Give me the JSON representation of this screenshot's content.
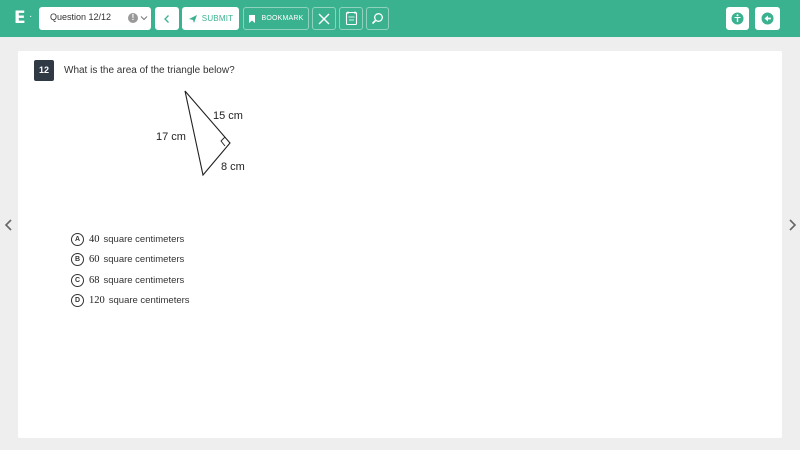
{
  "topbar": {
    "logo": "E",
    "question_select": "Question 12/12",
    "submit_label": "SUBMIT",
    "bookmark_label": "BOOKMARK",
    "colors": {
      "bar": "#3bb28f",
      "dark": "#2f3a45"
    },
    "icons": [
      "info-icon",
      "chevron-down-icon",
      "back-arrow-icon",
      "send-icon",
      "bookmark-icon",
      "close-icon",
      "calculator-icon",
      "search-icon",
      "accessibility-icon",
      "exit-icon"
    ]
  },
  "question": {
    "number": "12",
    "text": "What is the area of the triangle below?",
    "figure": {
      "side_hypotenuse": "17 cm",
      "side_a": "15 cm",
      "side_b": "8 cm"
    }
  },
  "choices": [
    {
      "letter": "A",
      "value": "40",
      "unit": "square centimeters"
    },
    {
      "letter": "B",
      "value": "60",
      "unit": "square centimeters"
    },
    {
      "letter": "C",
      "value": "68",
      "unit": "square centimeters"
    },
    {
      "letter": "D",
      "value": "120",
      "unit": "square centimeters"
    }
  ]
}
